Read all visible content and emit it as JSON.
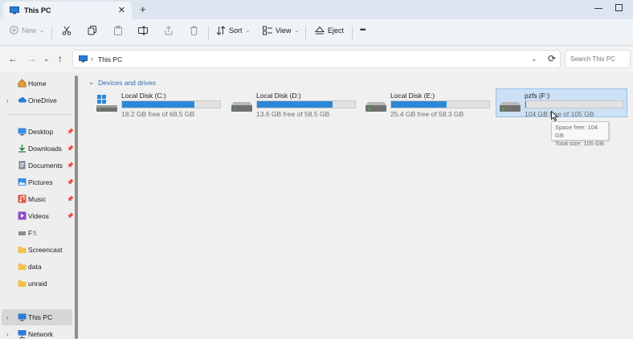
{
  "window": {
    "tab_title": "This PC",
    "tab_close": "✕",
    "new_tab": "+"
  },
  "toolbar": {
    "new_label": "New",
    "sort_label": "Sort",
    "view_label": "View",
    "eject_label": "Eject",
    "more_label": "•••"
  },
  "address": {
    "path": "This PC",
    "separator": "›",
    "search_placeholder": "Search This PC"
  },
  "sidebar": {
    "items": [
      {
        "label": "Home",
        "icon": "home-icon",
        "arrow": ""
      },
      {
        "label": "OneDrive",
        "icon": "cloud-icon",
        "arrow": "›"
      },
      {
        "label": "Desktop",
        "icon": "desktop-icon",
        "pinned": true
      },
      {
        "label": "Downloads",
        "icon": "download-icon",
        "pinned": true
      },
      {
        "label": "Documents",
        "icon": "document-icon",
        "pinned": true
      },
      {
        "label": "Pictures",
        "icon": "pictures-icon",
        "pinned": true
      },
      {
        "label": "Music",
        "icon": "music-icon",
        "pinned": true
      },
      {
        "label": "Videos",
        "icon": "videos-icon",
        "pinned": true
      },
      {
        "label": "F:\\",
        "icon": "drive-icon"
      },
      {
        "label": "Screencast",
        "icon": "folder-icon"
      },
      {
        "label": "data",
        "icon": "folder-icon"
      },
      {
        "label": "unraid",
        "icon": "folder-icon"
      },
      {
        "label": "This PC",
        "icon": "computer-icon",
        "arrow": "›"
      },
      {
        "label": "Network",
        "icon": "network-icon",
        "arrow": "›"
      }
    ]
  },
  "main": {
    "group_title": "Devices and drives",
    "drives": [
      {
        "name": "Local Disk (C:)",
        "free_text": "18.2 GB free of 68.5 GB",
        "used_fraction": 0.734
      },
      {
        "name": "Local Disk (D:)",
        "free_text": "13.6 GB free of 58.5 GB",
        "used_fraction": 0.768
      },
      {
        "name": "Local Disk (E:)",
        "free_text": "25.4 GB free of 58.3 GB",
        "used_fraction": 0.564
      },
      {
        "name": "pzfs (F:)",
        "free_text": "104 GB free of 105 GB",
        "used_fraction": 0.01
      }
    ],
    "tooltip": {
      "line1": "Space free: 104 GB",
      "line2": "Total size: 105 GB"
    }
  },
  "colors": {
    "accent": "#2b88d8",
    "selection": "#cce0f6",
    "group_header": "#2e6fb7"
  }
}
